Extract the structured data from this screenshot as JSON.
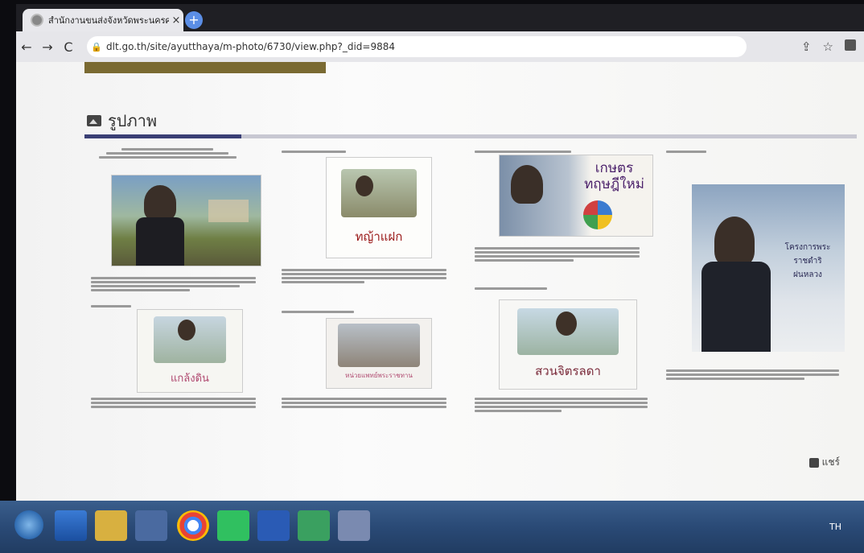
{
  "browser": {
    "tab_title": "สำนักงานขนส่งจังหวัดพระนครศรีอยุ",
    "tab_close": "×",
    "new_tab": "+",
    "url": "dlt.go.th/site/ayutthaya/m-photo/6730/view.php?_did=9884",
    "back": "←",
    "forward": "→",
    "reload": "C",
    "share_icon": "⇪",
    "star_icon": "☆"
  },
  "section": {
    "title": "รูปภาพ"
  },
  "posters": [
    {
      "title": "ทญ้าแฝก"
    },
    {
      "title": "เกษตร\nทฤษฎีใหม่"
    },
    {
      "title": "โครงการพระราชดำริ\nฝนหลวง"
    },
    {
      "title": "แกล้งดิน"
    },
    {
      "title": "หน่วยแพทย์พระราชทาน"
    },
    {
      "title": "สวนจิตรลดา"
    }
  ],
  "share": {
    "label": "แชร์"
  },
  "taskbar": {
    "lang": "TH"
  },
  "colors": {
    "accent": "#3a3f75",
    "page": "#f6f6f4",
    "taskbar": "#2a4a76"
  }
}
